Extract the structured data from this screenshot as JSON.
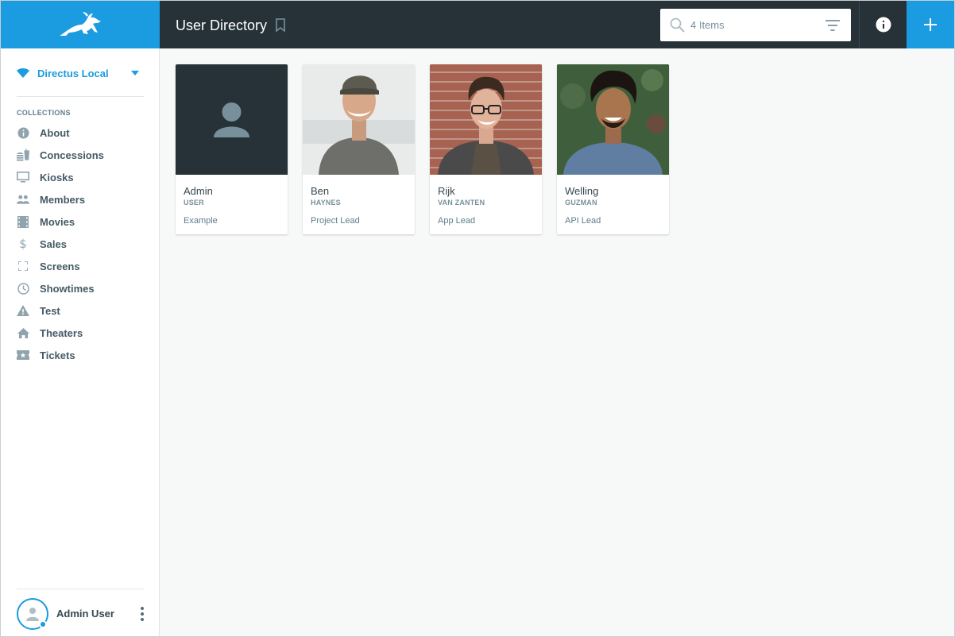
{
  "header": {
    "title": "User Directory",
    "search_placeholder": "4 Items"
  },
  "sidebar": {
    "project_name": "Directus Local",
    "collections_heading": "COLLECTIONS",
    "items": [
      {
        "label": "About",
        "icon": "info-icon"
      },
      {
        "label": "Concessions",
        "icon": "fastfood-icon"
      },
      {
        "label": "Kiosks",
        "icon": "monitor-icon"
      },
      {
        "label": "Members",
        "icon": "people-icon"
      },
      {
        "label": "Movies",
        "icon": "film-icon"
      },
      {
        "label": "Sales",
        "icon": "dollar-icon"
      },
      {
        "label": "Screens",
        "icon": "fullscreen-icon"
      },
      {
        "label": "Showtimes",
        "icon": "clock-icon"
      },
      {
        "label": "Test",
        "icon": "warning-icon"
      },
      {
        "label": "Theaters",
        "icon": "home-icon"
      },
      {
        "label": "Tickets",
        "icon": "ticket-icon"
      }
    ],
    "user_name": "Admin User"
  },
  "cards": [
    {
      "first_name": "Admin",
      "last_name": "USER",
      "title": "Example"
    },
    {
      "first_name": "Ben",
      "last_name": "HAYNES",
      "title": "Project Lead"
    },
    {
      "first_name": "Rijk",
      "last_name": "VAN ZANTEN",
      "title": "App Lead"
    },
    {
      "first_name": "Welling",
      "last_name": "GUZMAN",
      "title": "API Lead"
    }
  ],
  "colors": {
    "accent": "#1b9be0",
    "header_dark": "#263238",
    "sidebar_bg": "#ffffff",
    "content_bg": "#f7f8f8"
  }
}
